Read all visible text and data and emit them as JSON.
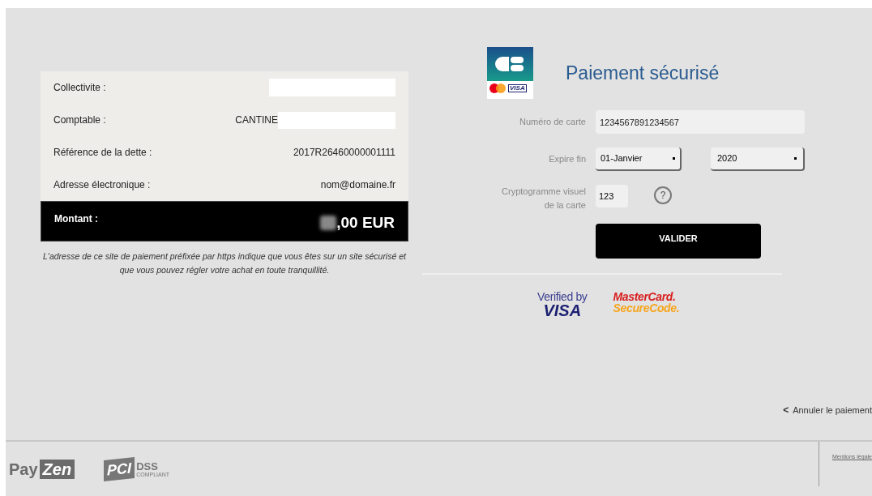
{
  "summary": {
    "rows": [
      {
        "label": "Collectivite :",
        "value": "",
        "masked": true
      },
      {
        "label": "Comptable :",
        "value": "CANTINE",
        "masked": true
      },
      {
        "label": "Référence de la dette :",
        "value": "2017R26460000001111",
        "masked": false
      },
      {
        "label": "Adresse électronique :",
        "value": "nom@domaine.fr",
        "masked": false
      }
    ],
    "total": {
      "label": "Montant :",
      "value": ",00 EUR",
      "blurred": true
    },
    "note": "L'adresse de ce site de paiement préfixée par https indique que vous êtes sur un site sécurisé et que vous pouvez régler votre achat en toute tranquillité."
  },
  "payment": {
    "cb_logo": {
      "text": "VISA"
    },
    "title": "Paiement sécurisé",
    "card_number": {
      "label": "Numéro de carte",
      "value": "1234567891234567"
    },
    "expiry": {
      "label": "Expire fin",
      "month": "01-Janvier",
      "year": "2020"
    },
    "cvv": {
      "label": "Cryptogramme visuel de la carte",
      "value": "123",
      "help": "?"
    },
    "submit": "VALIDER",
    "badges": [
      {
        "kind": "visa",
        "line1": "Verified by",
        "line2": "VISA"
      },
      {
        "kind": "mastercard",
        "line1": "MasterCard.",
        "line2": "SecureCode."
      }
    ],
    "cancel": {
      "arrow": "<",
      "label": "Annuler le paiement"
    }
  },
  "footer": {
    "payzen": [
      "Pay",
      "Zen"
    ],
    "pci": {
      "mark": "PCI",
      "dss": "DSS",
      "sub": "COMPLIANT"
    },
    "legal": "Mentions légale"
  }
}
